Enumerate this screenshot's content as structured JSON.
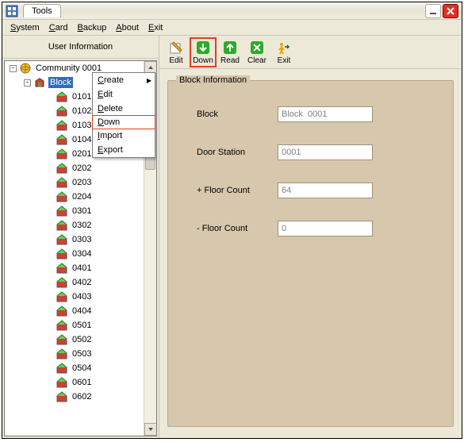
{
  "titlebar": {
    "tab": "Tools"
  },
  "menubar": {
    "items": [
      {
        "u": "S",
        "rest": "ystem"
      },
      {
        "u": "C",
        "rest": "ard"
      },
      {
        "u": "B",
        "rest": "ackup"
      },
      {
        "u": "A",
        "rest": "bout"
      },
      {
        "u": "E",
        "rest": "xit"
      }
    ]
  },
  "left_header": "User Information",
  "tree": {
    "root": "Community 0001",
    "block": "Block",
    "rooms": [
      "0203",
      "0204",
      "0301",
      "0302",
      "0303",
      "0304",
      "0401",
      "0402",
      "0403",
      "0404",
      "0501",
      "0502",
      "0503",
      "0504",
      "0601",
      "0602"
    ]
  },
  "hidden_by_menu": [
    "0101",
    "0102",
    "0103",
    "0104",
    "0201",
    "0202"
  ],
  "context_menu": {
    "items": [
      {
        "u": "C",
        "rest": "reate",
        "sub": true
      },
      {
        "u": "E",
        "rest": "dit"
      },
      {
        "u": "D",
        "rest": "elete"
      },
      {
        "u": "D",
        "rest": "own",
        "hl": true
      },
      {
        "u": "I",
        "rest": "mport"
      },
      {
        "u": "E",
        "rest": "xport"
      }
    ]
  },
  "toolbar": [
    {
      "label": "Edit",
      "icon": "edit",
      "color": "#2a7a2a"
    },
    {
      "label": "Down",
      "icon": "down",
      "color": "#2aab2a",
      "hl": true
    },
    {
      "label": "Read",
      "icon": "read",
      "color": "#2aab2a"
    },
    {
      "label": "Clear",
      "icon": "clear",
      "color": "#2aab2a"
    },
    {
      "label": "Exit",
      "icon": "exit",
      "color": "#e6a700"
    }
  ],
  "form": {
    "group_label": "Block Information",
    "rows": [
      {
        "label": "Block",
        "value": "Block  0001"
      },
      {
        "label": "Door Station",
        "value": "0001"
      },
      {
        "label": "+ Floor Count",
        "value": "64"
      },
      {
        "label": "- Floor Count",
        "value": "0"
      }
    ]
  }
}
